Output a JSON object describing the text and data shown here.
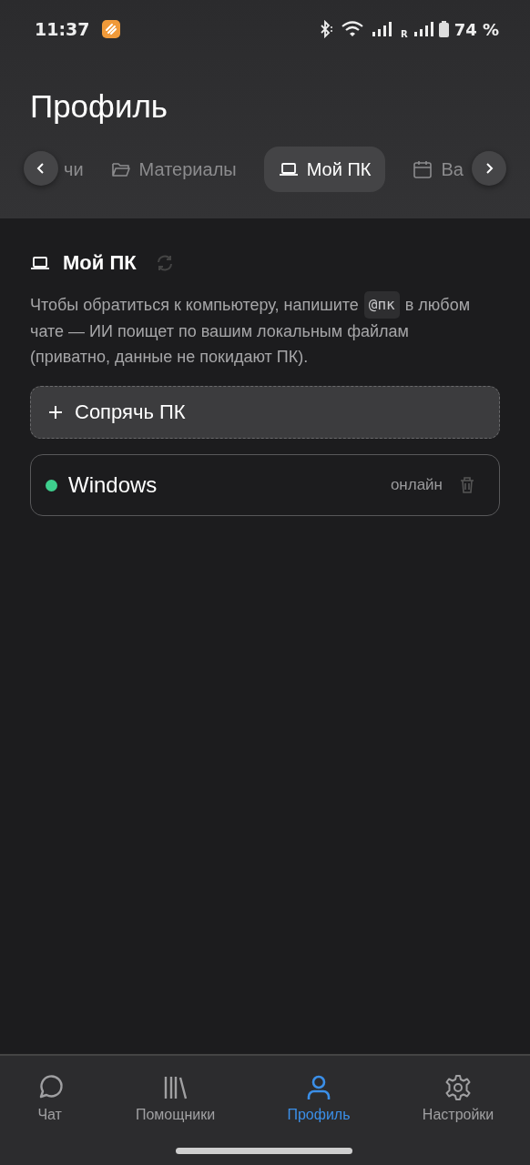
{
  "status_bar": {
    "time": "11:37",
    "battery_text": "74 %",
    "roaming": "R"
  },
  "header": {
    "title": "Профиль"
  },
  "tabs": [
    {
      "label": "чи",
      "selected": false
    },
    {
      "label": "Материалы",
      "selected": false
    },
    {
      "label": "Мой ПК",
      "selected": true
    },
    {
      "label": "Ва",
      "selected": false
    }
  ],
  "section": {
    "title": "Мой ПК",
    "description_line_1": "Чтобы обратиться к компьютеру, напишите",
    "mention": "@пк",
    "description_line_1_end": "в любом",
    "description_rest": "чате — ИИ поищет по вашим локальным файлам (приватно, данные не покидают ПК).",
    "pair_button": "Сопрячь ПК",
    "devices": [
      {
        "name": "Windows",
        "status": "онлайн",
        "color": "#3ecf8e"
      }
    ]
  },
  "bottom_nav": [
    {
      "label": "Чат",
      "selected": false
    },
    {
      "label": "Помощники",
      "selected": false
    },
    {
      "label": "Профиль",
      "selected": true
    },
    {
      "label": "Настройки",
      "selected": false
    }
  ]
}
